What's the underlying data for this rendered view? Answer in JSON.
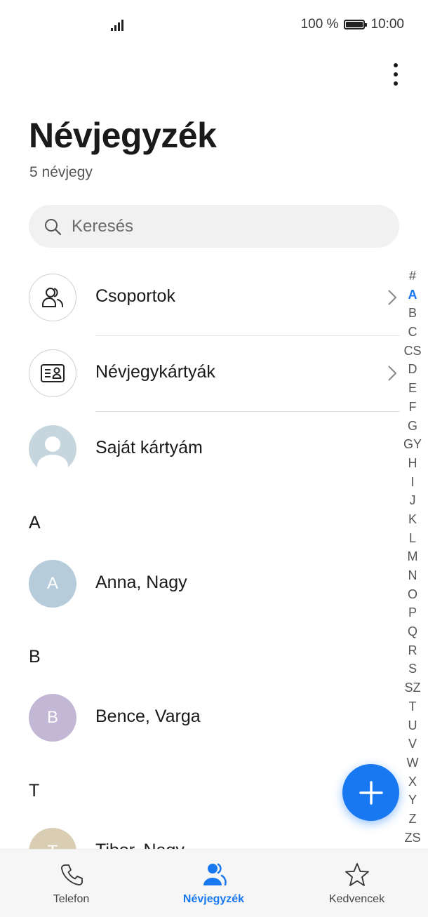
{
  "status_bar": {
    "battery": "100 %",
    "time": "10:00"
  },
  "header": {
    "title": "Névjegyzék",
    "subtitle": "5 névjegy"
  },
  "search": {
    "placeholder": "Keresés"
  },
  "menu": [
    {
      "label": "Csoportok",
      "icon": "group-icon"
    },
    {
      "label": "Névjegykártyák",
      "icon": "business-card-icon"
    },
    {
      "label": "Saját kártyám",
      "icon": "profile-placeholder-icon"
    }
  ],
  "sections": [
    {
      "letter": "A",
      "contact": {
        "initial": "A",
        "name": "Anna, Nagy",
        "color": "#b6ccdb"
      }
    },
    {
      "letter": "B",
      "contact": {
        "initial": "B",
        "name": "Bence, Varga",
        "color": "#c2b7d5"
      }
    },
    {
      "letter": "T",
      "contact": {
        "initial": "T",
        "name": "Tibor, Nagy",
        "color": "#d9cdb4"
      }
    }
  ],
  "index_letters": [
    "#",
    "A",
    "B",
    "C",
    "CS",
    "D",
    "E",
    "F",
    "G",
    "GY",
    "H",
    "I",
    "J",
    "K",
    "L",
    "M",
    "N",
    "O",
    "P",
    "Q",
    "R",
    "S",
    "SZ",
    "T",
    "U",
    "V",
    "W",
    "X",
    "Y",
    "Z",
    "ZS"
  ],
  "index_active": "A",
  "bottom_nav": {
    "tabs": [
      {
        "label": "Telefon",
        "icon": "phone-icon"
      },
      {
        "label": "Névjegyzék",
        "icon": "contacts-icon",
        "active": true
      },
      {
        "label": "Kedvencek",
        "icon": "star-icon"
      }
    ]
  },
  "colors": {
    "accent": "#1778f2"
  }
}
